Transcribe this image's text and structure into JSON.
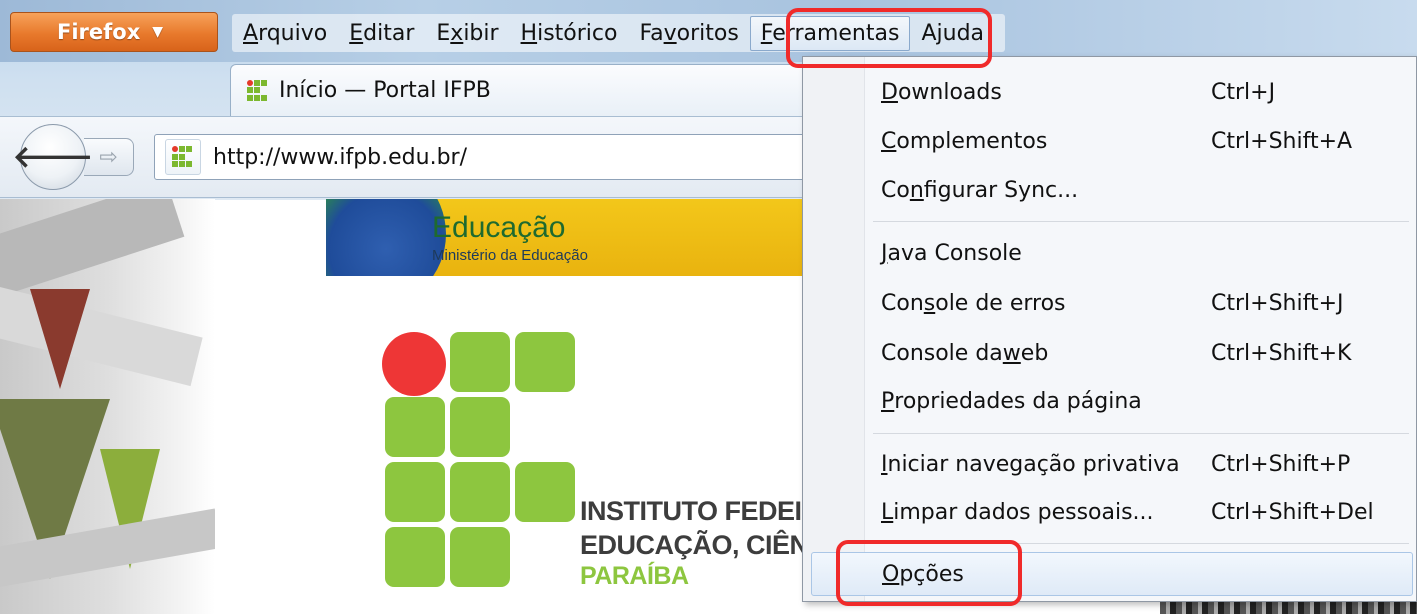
{
  "window": {
    "app_button_label": "Firefox",
    "app_button_caret": "▼"
  },
  "menubar": {
    "items": [
      {
        "mnemonic": "A",
        "rest": "rquivo",
        "prefix": ""
      },
      {
        "mnemonic": "E",
        "rest": "ditar",
        "prefix": ""
      },
      {
        "prefix": "E",
        "mnemonic": "x",
        "rest": "ibir"
      },
      {
        "mnemonic": "H",
        "rest": "istórico",
        "prefix": ""
      },
      {
        "prefix": "Fa",
        "mnemonic": "v",
        "rest": "oritos"
      },
      {
        "mnemonic": "F",
        "rest": "erramentas",
        "prefix": ""
      },
      {
        "prefix": "A",
        "mnemonic": "j",
        "rest": "uda"
      }
    ]
  },
  "tab": {
    "title": "Início — Portal IFPB"
  },
  "navigation": {
    "back_glyph": "🡐",
    "forward_glyph": "⇨",
    "url": "http://www.ifpb.edu.br/"
  },
  "page": {
    "banner_title": "Educação",
    "banner_subtitle": "Ministério da Educação",
    "institution_line1": "INSTITUTO FEDEI",
    "institution_line2": "EDUCAÇÃO, CIÊN",
    "institution_state": "PARAÍBA"
  },
  "tools_menu": {
    "items": [
      {
        "prefix": "",
        "mnemonic": "D",
        "rest": "ownloads",
        "shortcut": "Ctrl+J"
      },
      {
        "prefix": "",
        "mnemonic": "C",
        "rest": "omplementos",
        "shortcut": "Ctrl+Shift+A"
      },
      {
        "prefix": "Co",
        "mnemonic": "n",
        "rest": "figurar Sync...",
        "shortcut": ""
      },
      {
        "prefix": "",
        "mnemonic": "J",
        "rest": "ava Console",
        "shortcut": ""
      },
      {
        "prefix": "Con",
        "mnemonic": "s",
        "rest": "ole de erros",
        "shortcut": "Ctrl+Shift+J"
      },
      {
        "prefix": "Console da ",
        "mnemonic": "w",
        "rest": "eb",
        "shortcut": "Ctrl+Shift+K"
      },
      {
        "prefix": "",
        "mnemonic": "P",
        "rest": "ropriedades da página",
        "shortcut": ""
      },
      {
        "prefix": "",
        "mnemonic": "I",
        "rest": "niciar navegação privativa",
        "shortcut": "Ctrl+Shift+P"
      },
      {
        "prefix": "",
        "mnemonic": "L",
        "rest": "impar dados pessoais...",
        "shortcut": "Ctrl+Shift+Del"
      },
      {
        "prefix": "",
        "mnemonic": "O",
        "rest": "pções",
        "shortcut": ""
      }
    ]
  },
  "colors": {
    "highlight": "#f02a2a",
    "firefox_orange": "#e8792c",
    "ifpb_green": "#8dc63f",
    "ifpb_red": "#ee3636"
  }
}
